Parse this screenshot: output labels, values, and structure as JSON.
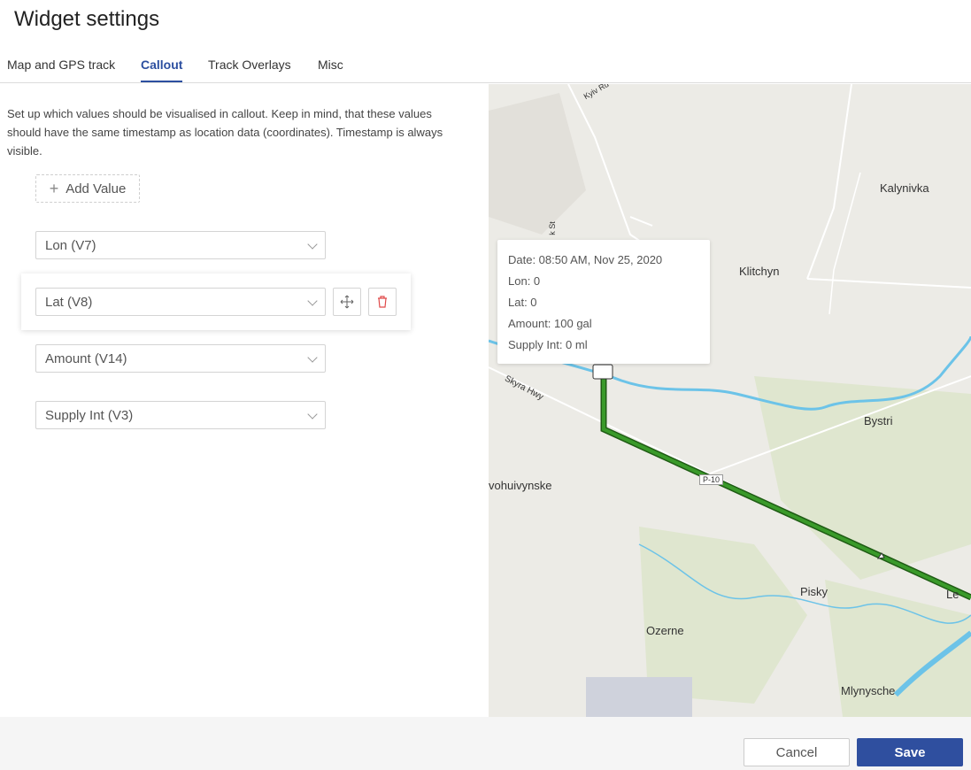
{
  "title": "Widget settings",
  "tabs": [
    {
      "label": "Map and GPS track"
    },
    {
      "label": "Callout"
    },
    {
      "label": "Track Overlays"
    },
    {
      "label": "Misc"
    }
  ],
  "active_tab": "Callout",
  "description": "Set up which values should be visualised in callout. Keep in mind, that these values should have the same timestamp as location data (coordinates). Timestamp is always visible.",
  "add_value_label": "Add Value",
  "values": [
    {
      "label": "Lon (V7)"
    },
    {
      "label": "Lat (V8)"
    },
    {
      "label": "Amount (V14)"
    },
    {
      "label": "Supply Int (V3)"
    }
  ],
  "icons": {
    "move": "move-icon",
    "delete": "trash-icon",
    "add": "plus-icon"
  },
  "map": {
    "labels": {
      "kalynivka": "Kalynivka",
      "klitchyn": "Klitchyn",
      "bystri": "Bystri",
      "krivohuivynske": "vohuivynske",
      "pisky": "Pisky",
      "ozerne": "Ozerne",
      "mlynysche": "Mlynysche",
      "skyra_hwy": "Skyra Hwy",
      "kyiv_rd": "Kyiv Rd",
      "st": "k St",
      "road_badge": "P-10",
      "edge_town": "Le"
    },
    "callout": {
      "date": "Date: 08:50 AM, Nov 25, 2020",
      "lon": "Lon: 0",
      "lat": "Lat: 0",
      "amount": "Amount: 100 gal",
      "supply": "Supply Int: 0 ml"
    },
    "track_color": "#3a9a2a",
    "water_color": "#6cc3e8"
  },
  "footer": {
    "cancel_label": "Cancel",
    "save_label": "Save"
  },
  "colors": {
    "accent": "#2f4f9f",
    "danger": "#e04a4a"
  }
}
